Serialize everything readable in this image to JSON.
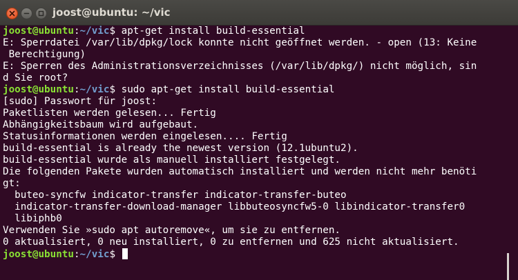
{
  "window": {
    "title": "joost@ubuntu: ~/vic"
  },
  "prompt": {
    "user_host": "joost@ubuntu",
    "sep": ":",
    "path": "~/vic",
    "symbol": "$ "
  },
  "terminal": {
    "lines": [
      {
        "kind": "prompt",
        "cmd": "apt-get install build-essential"
      },
      {
        "kind": "output",
        "text": "E: Sperrdatei /var/lib/dpkg/lock konnte nicht geöffnet werden. - open (13: Keine"
      },
      {
        "kind": "output",
        "text": " Berechtigung)"
      },
      {
        "kind": "output",
        "text": "E: Sperren des Administrationsverzeichnisses (/var/lib/dpkg/) nicht möglich, sin"
      },
      {
        "kind": "output",
        "text": "d Sie root?"
      },
      {
        "kind": "prompt",
        "cmd": "sudo apt-get install build-essential"
      },
      {
        "kind": "output",
        "text": "[sudo] Passwort für joost:"
      },
      {
        "kind": "output",
        "text": "Paketlisten werden gelesen... Fertig"
      },
      {
        "kind": "output",
        "text": "Abhängigkeitsbaum wird aufgebaut."
      },
      {
        "kind": "output",
        "text": "Statusinformationen werden eingelesen.... Fertig"
      },
      {
        "kind": "output",
        "text": "build-essential is already the newest version (12.1ubuntu2)."
      },
      {
        "kind": "output",
        "text": "build-essential wurde als manuell installiert festgelegt."
      },
      {
        "kind": "output",
        "text": "Die folgenden Pakete wurden automatisch installiert und werden nicht mehr benöti"
      },
      {
        "kind": "output",
        "text": "gt:"
      },
      {
        "kind": "output",
        "text": "  buteo-syncfw indicator-transfer indicator-transfer-buteo"
      },
      {
        "kind": "output",
        "text": "  indicator-transfer-download-manager libbuteosyncfw5-0 libindicator-transfer0"
      },
      {
        "kind": "output",
        "text": "  libiphb0"
      },
      {
        "kind": "output",
        "text": "Verwenden Sie »sudo apt autoremove«, um sie zu entfernen."
      },
      {
        "kind": "output",
        "text": "0 aktualisiert, 0 neu installiert, 0 zu entfernen und 625 nicht aktualisiert."
      },
      {
        "kind": "prompt",
        "cmd": "",
        "cursor": true
      }
    ]
  },
  "icons": {
    "close": "close-icon",
    "minimize": "minimize-icon",
    "maximize": "maximize-icon"
  },
  "colors": {
    "background": "#300a24",
    "titlebar": "#3c3b37",
    "prompt_user": "#8ae234",
    "prompt_path": "#729fcf",
    "text": "#ffffff",
    "close_button": "#df4a16"
  }
}
